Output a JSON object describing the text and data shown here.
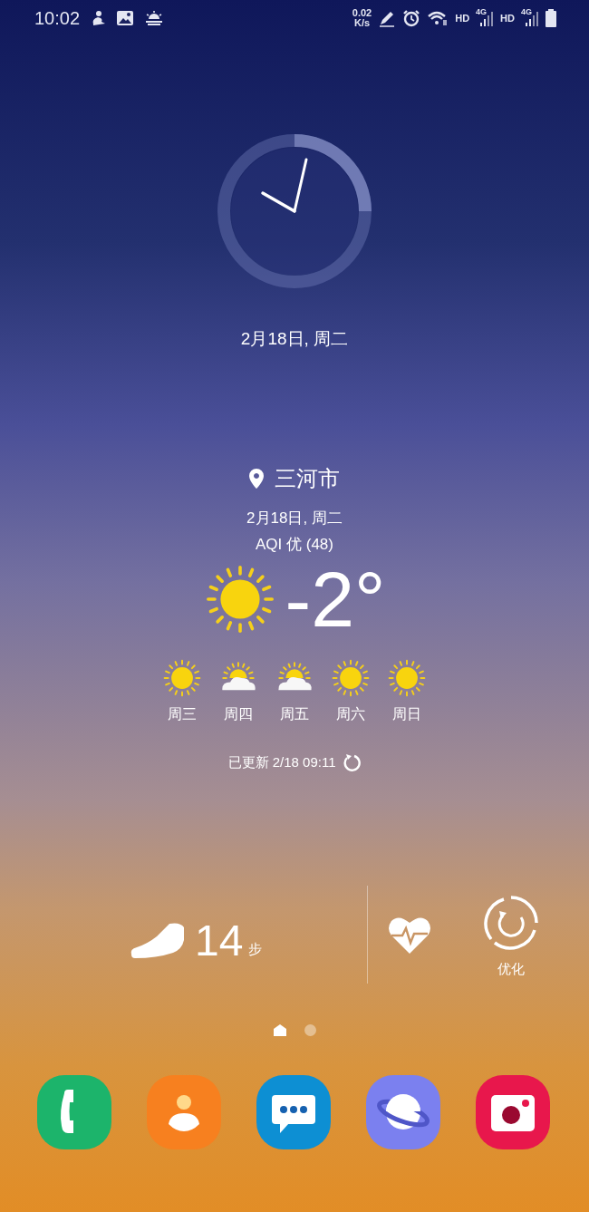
{
  "status_bar": {
    "time": "10:02",
    "net_speed": "0.02",
    "net_unit": "K/s",
    "sim_labels": [
      {
        "hd": "HD",
        "network": "4G"
      },
      {
        "hd": "HD",
        "network": "4G"
      }
    ]
  },
  "clock_widget": {
    "date": "2月18日, 周二"
  },
  "weather": {
    "location": "三河市",
    "date": "2月18日, 周二",
    "aqi": "AQI 优 (48)",
    "current": {
      "kind": "sunny",
      "temperature": "-2°"
    },
    "forecast": [
      {
        "day": "周三",
        "kind": "sunny"
      },
      {
        "day": "周四",
        "kind": "partly_cloudy"
      },
      {
        "day": "周五",
        "kind": "partly_cloudy"
      },
      {
        "day": "周六",
        "kind": "sunny"
      },
      {
        "day": "周日",
        "kind": "sunny"
      }
    ],
    "updated": "已更新 2/18 09:11"
  },
  "health_widget": {
    "steps": "14",
    "steps_unit": "步",
    "optimize_label": "优化"
  },
  "page_indicator": [
    {
      "kind": "home",
      "selected": true
    },
    {
      "kind": "dot",
      "selected": false
    }
  ],
  "dock": [
    {
      "kind": "phone"
    },
    {
      "kind": "contacts"
    },
    {
      "kind": "messages"
    },
    {
      "kind": "internet"
    },
    {
      "kind": "camera"
    }
  ]
}
